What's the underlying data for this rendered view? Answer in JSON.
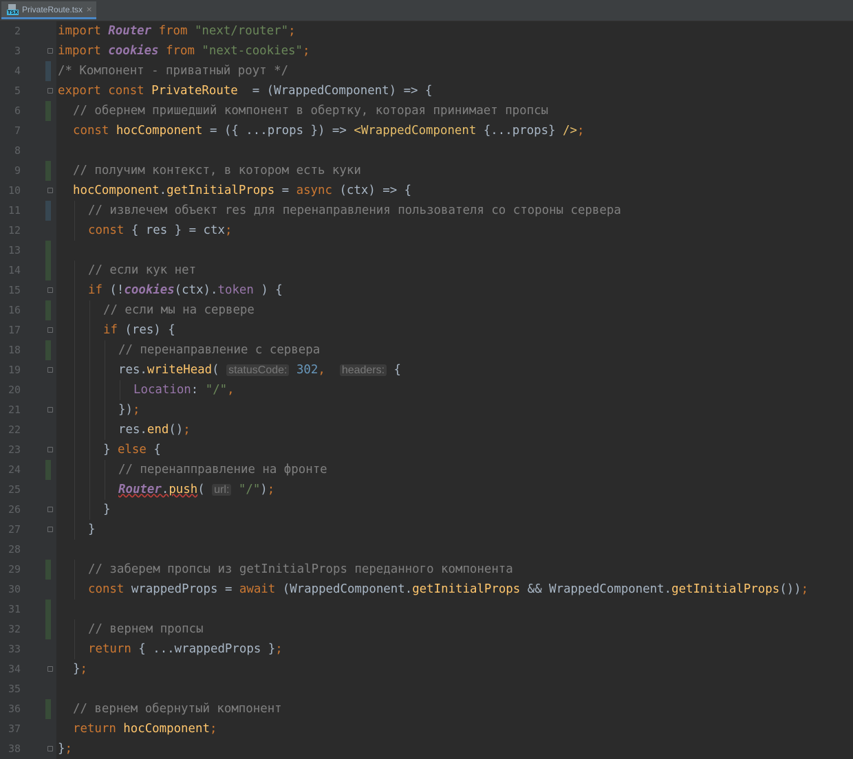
{
  "tab": {
    "title": "PrivateRoute.tsx",
    "close": "×",
    "icon": "tsx-file-icon",
    "icon_label": "TSX"
  },
  "lines": [
    {
      "n": "2",
      "mark": "",
      "fold": "",
      "indent": 0,
      "parts": [
        [
          "kw",
          "import "
        ],
        [
          "it",
          "Router"
        ],
        [
          "kw",
          " from "
        ],
        [
          "str",
          "\"next/router\""
        ],
        [
          "kw",
          ";"
        ]
      ]
    },
    {
      "n": "3",
      "mark": "",
      "fold": "close",
      "indent": 0,
      "parts": [
        [
          "kw",
          "import "
        ],
        [
          "it",
          "cookies"
        ],
        [
          "kw",
          " from "
        ],
        [
          "str",
          "\"next-cookies\""
        ],
        [
          "kw",
          ";"
        ]
      ]
    },
    {
      "n": "4",
      "mark": "blue",
      "fold": "",
      "indent": 0,
      "parts": [
        [
          "cm",
          "/* Компонент - приватный роут */"
        ]
      ]
    },
    {
      "n": "5",
      "mark": "",
      "fold": "open",
      "indent": 0,
      "parts": [
        [
          "kw",
          "export const "
        ],
        [
          "fn",
          "PrivateRoute"
        ],
        [
          "",
          "  = (WrappedComponent) => {"
        ]
      ]
    },
    {
      "n": "6",
      "mark": "green",
      "fold": "",
      "indent": 1,
      "parts": [
        [
          "cm",
          "// обернем пришедший компонент в обертку, которая принимает пропсы"
        ]
      ]
    },
    {
      "n": "7",
      "mark": "",
      "fold": "",
      "indent": 1,
      "parts": [
        [
          "kw",
          "const "
        ],
        [
          "fn",
          "hocComponent"
        ],
        [
          "",
          " = ({ ...props }) => "
        ],
        [
          "jsx",
          "<WrappedComponent "
        ],
        [
          "",
          "{...props} "
        ],
        [
          "jsx",
          "/>"
        ],
        [
          "kw",
          ";"
        ]
      ]
    },
    {
      "n": "8",
      "mark": "",
      "fold": "",
      "indent": 0,
      "parts": []
    },
    {
      "n": "9",
      "mark": "green",
      "fold": "",
      "indent": 1,
      "parts": [
        [
          "cm",
          "// получим контекст, в котором есть куки"
        ]
      ]
    },
    {
      "n": "10",
      "mark": "",
      "fold": "open",
      "indent": 1,
      "parts": [
        [
          "fn",
          "hocComponent"
        ],
        [
          "",
          "."
        ],
        [
          "fn",
          "getInitialProps"
        ],
        [
          "",
          " = "
        ],
        [
          "kw",
          "async "
        ],
        [
          "",
          "(ctx) => {"
        ]
      ]
    },
    {
      "n": "11",
      "mark": "blue",
      "fold": "",
      "indent": 2,
      "parts": [
        [
          "cm",
          "// извлечем объект res для перенаправления пользователя со стороны сервера"
        ]
      ]
    },
    {
      "n": "12",
      "mark": "",
      "fold": "",
      "indent": 2,
      "parts": [
        [
          "kw",
          "const "
        ],
        [
          "",
          "{ res } = ctx"
        ],
        [
          "kw",
          ";"
        ]
      ]
    },
    {
      "n": "13",
      "mark": "green",
      "fold": "",
      "indent": 0,
      "parts": []
    },
    {
      "n": "14",
      "mark": "green",
      "fold": "",
      "indent": 2,
      "parts": [
        [
          "cm",
          "// если кук нет"
        ]
      ]
    },
    {
      "n": "15",
      "mark": "",
      "fold": "open",
      "indent": 2,
      "parts": [
        [
          "kw",
          "if "
        ],
        [
          "",
          "(!"
        ],
        [
          "it",
          "cookies"
        ],
        [
          "",
          "(ctx)."
        ],
        [
          "prop",
          "token"
        ],
        [
          "",
          " ) {"
        ]
      ]
    },
    {
      "n": "16",
      "mark": "green",
      "fold": "",
      "indent": 3,
      "parts": [
        [
          "cm",
          "// если мы на сервере"
        ]
      ]
    },
    {
      "n": "17",
      "mark": "",
      "fold": "open",
      "indent": 3,
      "parts": [
        [
          "kw",
          "if "
        ],
        [
          "",
          "(res) {"
        ]
      ]
    },
    {
      "n": "18",
      "mark": "green",
      "fold": "",
      "indent": 4,
      "parts": [
        [
          "cm",
          "// перенаправление с сервера"
        ]
      ]
    },
    {
      "n": "19",
      "mark": "",
      "fold": "open",
      "indent": 4,
      "parts": [
        [
          "",
          "res."
        ],
        [
          "fn",
          "writeHead"
        ],
        [
          "",
          "( "
        ],
        [
          "hint",
          "statusCode:"
        ],
        [
          "",
          " "
        ],
        [
          "num",
          "302"
        ],
        [
          "kw",
          ", "
        ],
        [
          "",
          " "
        ],
        [
          "hint",
          "headers:"
        ],
        [
          "",
          " {"
        ]
      ]
    },
    {
      "n": "20",
      "mark": "",
      "fold": "",
      "indent": 5,
      "parts": [
        [
          "prop",
          "Location"
        ],
        [
          "",
          ": "
        ],
        [
          "str",
          "\"/\""
        ],
        [
          "kw",
          ","
        ]
      ]
    },
    {
      "n": "21",
      "mark": "",
      "fold": "close",
      "indent": 4,
      "parts": [
        [
          "",
          "})"
        ],
        [
          "kw",
          ";"
        ]
      ]
    },
    {
      "n": "22",
      "mark": "",
      "fold": "",
      "indent": 4,
      "parts": [
        [
          "",
          "res."
        ],
        [
          "fn",
          "end"
        ],
        [
          "",
          "()"
        ],
        [
          "kw",
          ";"
        ]
      ]
    },
    {
      "n": "23",
      "mark": "",
      "fold": "open",
      "indent": 3,
      "parts": [
        [
          "",
          "} "
        ],
        [
          "kw",
          "else "
        ],
        [
          "",
          "{"
        ]
      ]
    },
    {
      "n": "24",
      "mark": "green",
      "fold": "",
      "indent": 4,
      "parts": [
        [
          "cm",
          "// перенаппрaвление на фронте"
        ]
      ]
    },
    {
      "n": "25",
      "mark": "",
      "fold": "",
      "indent": 4,
      "parts": [
        [
          "it warn",
          "Router"
        ],
        [
          "warn",
          "."
        ],
        [
          "fn warn",
          "push"
        ],
        [
          "",
          "( "
        ],
        [
          "hint",
          "url:"
        ],
        [
          "",
          " "
        ],
        [
          "str",
          "\"/\""
        ],
        [
          "",
          ")"
        ],
        [
          "kw",
          ";"
        ]
      ]
    },
    {
      "n": "26",
      "mark": "",
      "fold": "close",
      "indent": 3,
      "parts": [
        [
          "",
          "}"
        ]
      ]
    },
    {
      "n": "27",
      "mark": "",
      "fold": "close",
      "indent": 2,
      "parts": [
        [
          "",
          "}"
        ]
      ]
    },
    {
      "n": "28",
      "mark": "",
      "fold": "",
      "indent": 0,
      "parts": []
    },
    {
      "n": "29",
      "mark": "green",
      "fold": "",
      "indent": 2,
      "parts": [
        [
          "cm",
          "// заберем пропсы из getInitialProps переданного компонента"
        ]
      ]
    },
    {
      "n": "30",
      "mark": "",
      "fold": "",
      "indent": 2,
      "parts": [
        [
          "kw",
          "const "
        ],
        [
          "",
          "wrappedProps = "
        ],
        [
          "kw",
          "await "
        ],
        [
          "",
          "(WrappedComponent."
        ],
        [
          "fn",
          "getInitialProps"
        ],
        [
          "",
          " && WrappedComponent."
        ],
        [
          "fn",
          "getInitialProps"
        ],
        [
          "",
          "())"
        ],
        [
          "kw",
          ";"
        ]
      ]
    },
    {
      "n": "31",
      "mark": "green",
      "fold": "",
      "indent": 0,
      "parts": []
    },
    {
      "n": "32",
      "mark": "green",
      "fold": "",
      "indent": 2,
      "parts": [
        [
          "cm",
          "// вернем пропсы"
        ]
      ]
    },
    {
      "n": "33",
      "mark": "",
      "fold": "",
      "indent": 2,
      "parts": [
        [
          "kw",
          "return "
        ],
        [
          "",
          "{ ...wrappedProps }"
        ],
        [
          "kw",
          ";"
        ]
      ]
    },
    {
      "n": "34",
      "mark": "",
      "fold": "close",
      "indent": 1,
      "parts": [
        [
          "",
          "}"
        ],
        [
          "kw",
          ";"
        ]
      ]
    },
    {
      "n": "35",
      "mark": "",
      "fold": "",
      "indent": 0,
      "parts": []
    },
    {
      "n": "36",
      "mark": "green",
      "fold": "",
      "indent": 1,
      "parts": [
        [
          "cm",
          "// вернем обернутый компонент"
        ]
      ]
    },
    {
      "n": "37",
      "mark": "",
      "fold": "",
      "indent": 1,
      "parts": [
        [
          "kw",
          "return "
        ],
        [
          "fn",
          "hocComponent"
        ],
        [
          "kw",
          ";"
        ]
      ]
    },
    {
      "n": "38",
      "mark": "",
      "fold": "close",
      "indent": 0,
      "parts": [
        [
          "",
          "}"
        ],
        [
          "kw",
          ";"
        ]
      ]
    }
  ]
}
